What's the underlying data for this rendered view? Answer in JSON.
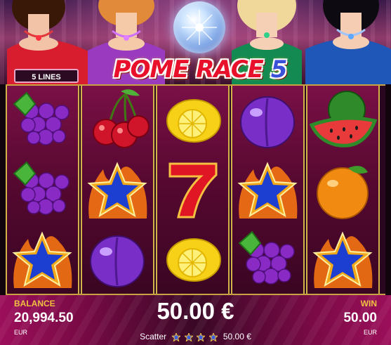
{
  "game": {
    "logo_part1": "POME",
    "logo_part2": "RACE",
    "logo_number": "5",
    "lines_label": "5 LINES"
  },
  "reels": [
    [
      "grapes-icon",
      "grapes-icon",
      "star-icon"
    ],
    [
      "cherry-icon",
      "star-icon",
      "plum-icon"
    ],
    [
      "lemon-icon",
      "seven-icon",
      "lemon-icon"
    ],
    [
      "plum-icon",
      "star-icon",
      "grapes-icon"
    ],
    [
      "watermelon-icon",
      "orange-icon",
      "star-icon"
    ]
  ],
  "balance": {
    "label": "BALANCE",
    "value": "20,994.50",
    "currency": "EUR"
  },
  "bet": {
    "value": "50.00 €"
  },
  "scatter": {
    "label": "Scatter",
    "payout": "50.00 €",
    "star_count": 4
  },
  "win": {
    "label": "WIN",
    "value": "50.00",
    "currency": "EUR"
  },
  "colors": {
    "accent_gold": "#f0c040",
    "reel_background": "#7a1046",
    "logo_red": "#e8102a",
    "star_blue": "#1d3fd1"
  }
}
